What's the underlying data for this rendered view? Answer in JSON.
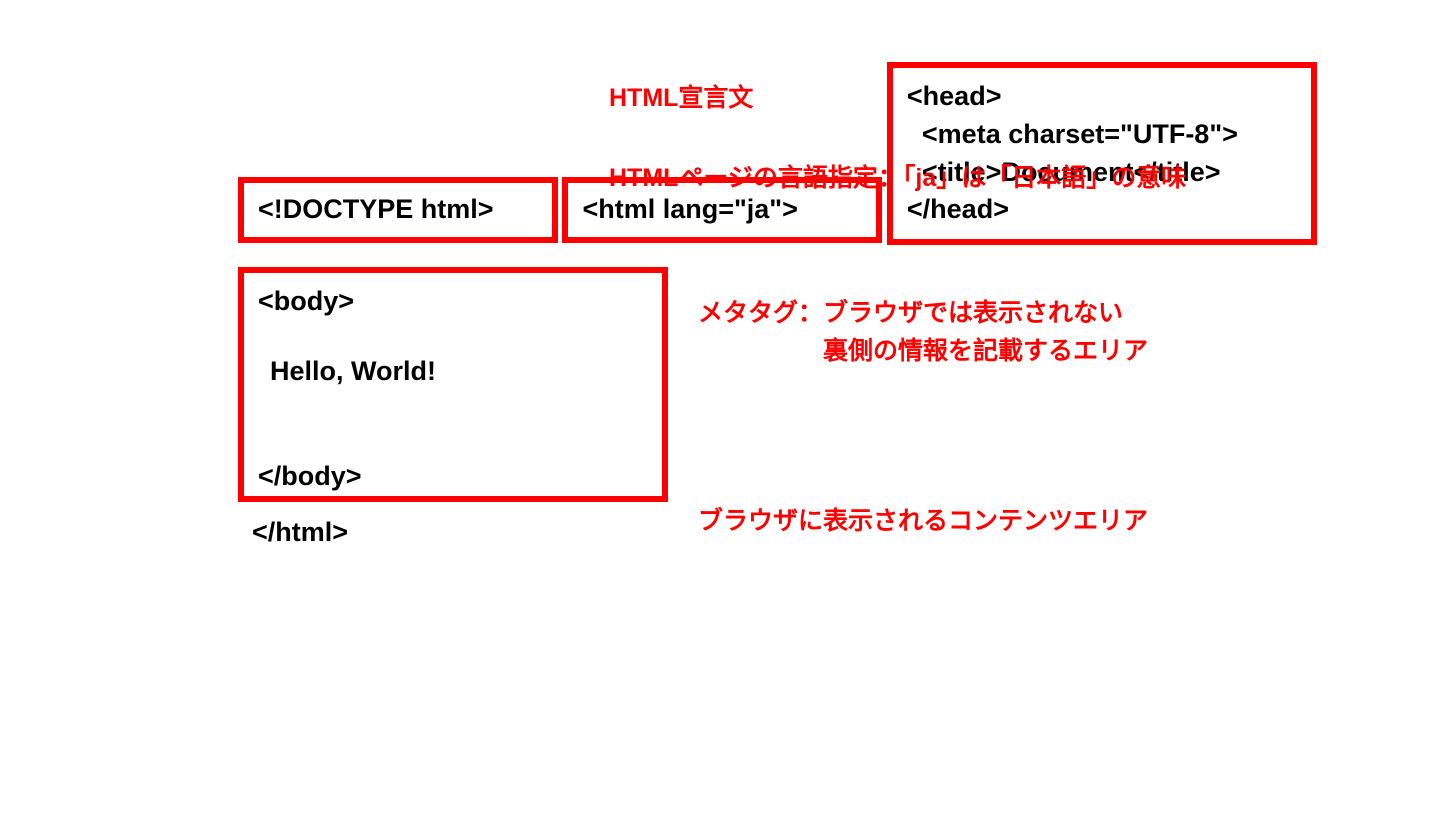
{
  "boxes": {
    "doctype": "<!DOCTYPE html>",
    "html_open": "<html lang=\"ja\">",
    "head_block": "<head>\n  <meta charset=\"UTF-8\">\n  <title>Document</title>\n</head>",
    "body_open": "<body>",
    "body_content": "Hello, World!",
    "body_close": "</body>",
    "html_close": "</html>"
  },
  "annotations": {
    "doctype_label": "HTML宣言文",
    "html_lang_label": "HTMLページの言語指定：「ja」は「日本語」の意味",
    "head_label": "メタタグ：ブラウザでは表示されない\n　　　　　裏側の情報を記載するエリア",
    "body_label": "ブラウザに表示されるコンテンツエリア"
  }
}
